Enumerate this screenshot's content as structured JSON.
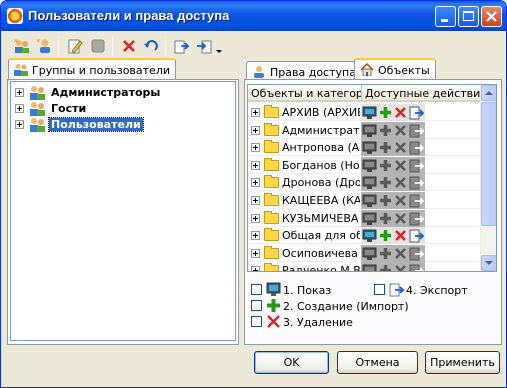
{
  "window": {
    "title": "Пользователи и права доступа"
  },
  "left_panel": {
    "tab": "Группы и пользователи",
    "tree": [
      {
        "label": "Администраторы",
        "selected": false
      },
      {
        "label": "Гости",
        "selected": false
      },
      {
        "label": "Пользователи",
        "selected": true
      }
    ]
  },
  "right_panel": {
    "tabs": [
      {
        "label": "Права доступа"
      },
      {
        "label": "Объекты"
      }
    ],
    "columns": {
      "objects": "Объекты и категор",
      "actions": "Доступные действия"
    },
    "rows": [
      {
        "name": "АРХИВ (АРХИВ",
        "active": true
      },
      {
        "name": "Администратор",
        "active": false
      },
      {
        "name": "Антропова (Ант",
        "active": false
      },
      {
        "name": "Богданов (Нова",
        "active": false
      },
      {
        "name": "Дронова (Дрон",
        "active": false
      },
      {
        "name": "КАЩЕЕВА (КАЦ",
        "active": false
      },
      {
        "name": "КУЗЬМИЧЕВА",
        "active": false
      },
      {
        "name": "Общая для обм",
        "active": true
      },
      {
        "name": "Осиповичева (С",
        "active": false
      },
      {
        "name": "Радченко М.В.",
        "active": false
      }
    ]
  },
  "legend": {
    "show": "1. Показ",
    "create": "2. Создание (Импорт)",
    "delete": "3. Удаление",
    "export": "4. Экспорт"
  },
  "buttons": {
    "ok": "OK",
    "cancel": "Отмена",
    "apply": "Применить"
  },
  "colors": {
    "title_bar": "#0a5ce8",
    "selection": "#316ac5",
    "action_bg": "#b4b4b4"
  }
}
